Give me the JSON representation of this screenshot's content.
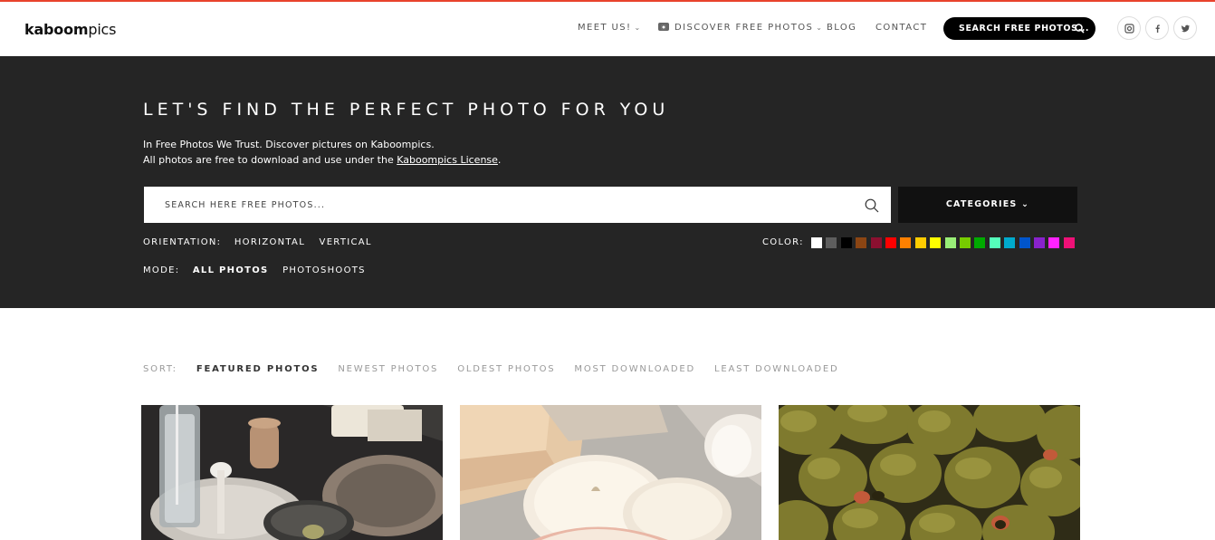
{
  "header": {
    "logo_bold": "kaboom",
    "logo_light": "pics",
    "nav": [
      {
        "label": "MEET US!",
        "has_dropdown": true
      },
      {
        "label": "DISCOVER FREE PHOTOS",
        "has_dropdown": true,
        "icon": "camera-icon"
      },
      {
        "label": "BLOG",
        "has_dropdown": false
      },
      {
        "label": "CONTACT",
        "has_dropdown": false
      }
    ],
    "search_label": "SEARCH FREE PHOTOS...",
    "social": [
      "instagram-icon",
      "facebook-icon",
      "twitter-icon"
    ],
    "accent_color": "#e8432c"
  },
  "hero": {
    "title": "LET'S FIND THE PERFECT PHOTO FOR YOU",
    "line1": "In Free Photos We Trust. Discover pictures on Kaboompics.",
    "line2_prefix": "All photos are free to download and use under the ",
    "line2_link": "Kaboompics License",
    "line2_suffix": ".",
    "search_placeholder": "SEARCH HERE FREE PHOTOS...",
    "categories_label": "CATEGORIES",
    "orientation": {
      "label": "ORIENTATION:",
      "options": [
        "HORIZONTAL",
        "VERTICAL"
      ]
    },
    "mode": {
      "label": "MODE:",
      "options": [
        "ALL PHOTOS",
        "PHOTOSHOOTS"
      ],
      "active": "ALL PHOTOS"
    },
    "color_label": "COLOR:",
    "colors": [
      "#ffffff",
      "#5e5e5e",
      "#000000",
      "#8b4513",
      "#8b1030",
      "#ff0000",
      "#ff8000",
      "#ffcc00",
      "#ffff00",
      "#99ee77",
      "#77cc00",
      "#00aa00",
      "#55ffbb",
      "#00aacc",
      "#0055cc",
      "#8822cc",
      "#ff22ff",
      "#ee1177"
    ]
  },
  "sort": {
    "label": "SORT:",
    "options": [
      "FEATURED PHOTOS",
      "NEWEST PHOTOS",
      "OLDEST PHOTOS",
      "MOST DOWNLOADED",
      "LEAST DOWNLOADED"
    ],
    "active": "FEATURED PHOTOS"
  },
  "photos": [
    {
      "name": "photo-bottles"
    },
    {
      "name": "photo-apple-slices"
    },
    {
      "name": "photo-olives"
    }
  ]
}
